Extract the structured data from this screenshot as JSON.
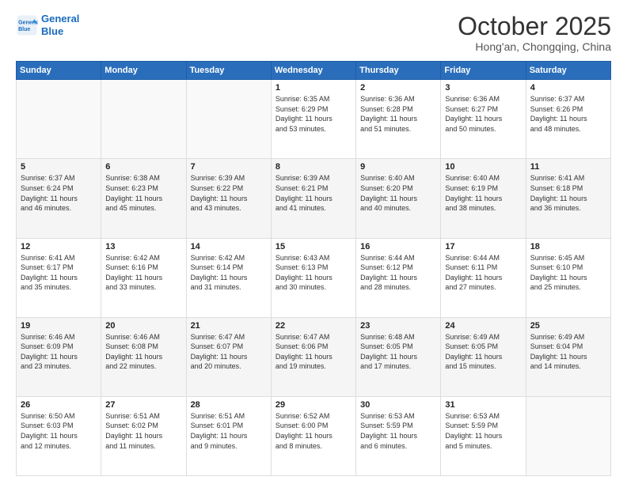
{
  "logo": {
    "line1": "General",
    "line2": "Blue"
  },
  "header": {
    "month": "October 2025",
    "location": "Hong'an, Chongqing, China"
  },
  "weekdays": [
    "Sunday",
    "Monday",
    "Tuesday",
    "Wednesday",
    "Thursday",
    "Friday",
    "Saturday"
  ],
  "weeks": [
    [
      {
        "day": "",
        "text": ""
      },
      {
        "day": "",
        "text": ""
      },
      {
        "day": "",
        "text": ""
      },
      {
        "day": "1",
        "text": "Sunrise: 6:35 AM\nSunset: 6:29 PM\nDaylight: 11 hours\nand 53 minutes."
      },
      {
        "day": "2",
        "text": "Sunrise: 6:36 AM\nSunset: 6:28 PM\nDaylight: 11 hours\nand 51 minutes."
      },
      {
        "day": "3",
        "text": "Sunrise: 6:36 AM\nSunset: 6:27 PM\nDaylight: 11 hours\nand 50 minutes."
      },
      {
        "day": "4",
        "text": "Sunrise: 6:37 AM\nSunset: 6:26 PM\nDaylight: 11 hours\nand 48 minutes."
      }
    ],
    [
      {
        "day": "5",
        "text": "Sunrise: 6:37 AM\nSunset: 6:24 PM\nDaylight: 11 hours\nand 46 minutes."
      },
      {
        "day": "6",
        "text": "Sunrise: 6:38 AM\nSunset: 6:23 PM\nDaylight: 11 hours\nand 45 minutes."
      },
      {
        "day": "7",
        "text": "Sunrise: 6:39 AM\nSunset: 6:22 PM\nDaylight: 11 hours\nand 43 minutes."
      },
      {
        "day": "8",
        "text": "Sunrise: 6:39 AM\nSunset: 6:21 PM\nDaylight: 11 hours\nand 41 minutes."
      },
      {
        "day": "9",
        "text": "Sunrise: 6:40 AM\nSunset: 6:20 PM\nDaylight: 11 hours\nand 40 minutes."
      },
      {
        "day": "10",
        "text": "Sunrise: 6:40 AM\nSunset: 6:19 PM\nDaylight: 11 hours\nand 38 minutes."
      },
      {
        "day": "11",
        "text": "Sunrise: 6:41 AM\nSunset: 6:18 PM\nDaylight: 11 hours\nand 36 minutes."
      }
    ],
    [
      {
        "day": "12",
        "text": "Sunrise: 6:41 AM\nSunset: 6:17 PM\nDaylight: 11 hours\nand 35 minutes."
      },
      {
        "day": "13",
        "text": "Sunrise: 6:42 AM\nSunset: 6:16 PM\nDaylight: 11 hours\nand 33 minutes."
      },
      {
        "day": "14",
        "text": "Sunrise: 6:42 AM\nSunset: 6:14 PM\nDaylight: 11 hours\nand 31 minutes."
      },
      {
        "day": "15",
        "text": "Sunrise: 6:43 AM\nSunset: 6:13 PM\nDaylight: 11 hours\nand 30 minutes."
      },
      {
        "day": "16",
        "text": "Sunrise: 6:44 AM\nSunset: 6:12 PM\nDaylight: 11 hours\nand 28 minutes."
      },
      {
        "day": "17",
        "text": "Sunrise: 6:44 AM\nSunset: 6:11 PM\nDaylight: 11 hours\nand 27 minutes."
      },
      {
        "day": "18",
        "text": "Sunrise: 6:45 AM\nSunset: 6:10 PM\nDaylight: 11 hours\nand 25 minutes."
      }
    ],
    [
      {
        "day": "19",
        "text": "Sunrise: 6:46 AM\nSunset: 6:09 PM\nDaylight: 11 hours\nand 23 minutes."
      },
      {
        "day": "20",
        "text": "Sunrise: 6:46 AM\nSunset: 6:08 PM\nDaylight: 11 hours\nand 22 minutes."
      },
      {
        "day": "21",
        "text": "Sunrise: 6:47 AM\nSunset: 6:07 PM\nDaylight: 11 hours\nand 20 minutes."
      },
      {
        "day": "22",
        "text": "Sunrise: 6:47 AM\nSunset: 6:06 PM\nDaylight: 11 hours\nand 19 minutes."
      },
      {
        "day": "23",
        "text": "Sunrise: 6:48 AM\nSunset: 6:05 PM\nDaylight: 11 hours\nand 17 minutes."
      },
      {
        "day": "24",
        "text": "Sunrise: 6:49 AM\nSunset: 6:05 PM\nDaylight: 11 hours\nand 15 minutes."
      },
      {
        "day": "25",
        "text": "Sunrise: 6:49 AM\nSunset: 6:04 PM\nDaylight: 11 hours\nand 14 minutes."
      }
    ],
    [
      {
        "day": "26",
        "text": "Sunrise: 6:50 AM\nSunset: 6:03 PM\nDaylight: 11 hours\nand 12 minutes."
      },
      {
        "day": "27",
        "text": "Sunrise: 6:51 AM\nSunset: 6:02 PM\nDaylight: 11 hours\nand 11 minutes."
      },
      {
        "day": "28",
        "text": "Sunrise: 6:51 AM\nSunset: 6:01 PM\nDaylight: 11 hours\nand 9 minutes."
      },
      {
        "day": "29",
        "text": "Sunrise: 6:52 AM\nSunset: 6:00 PM\nDaylight: 11 hours\nand 8 minutes."
      },
      {
        "day": "30",
        "text": "Sunrise: 6:53 AM\nSunset: 5:59 PM\nDaylight: 11 hours\nand 6 minutes."
      },
      {
        "day": "31",
        "text": "Sunrise: 6:53 AM\nSunset: 5:59 PM\nDaylight: 11 hours\nand 5 minutes."
      },
      {
        "day": "",
        "text": ""
      }
    ]
  ]
}
